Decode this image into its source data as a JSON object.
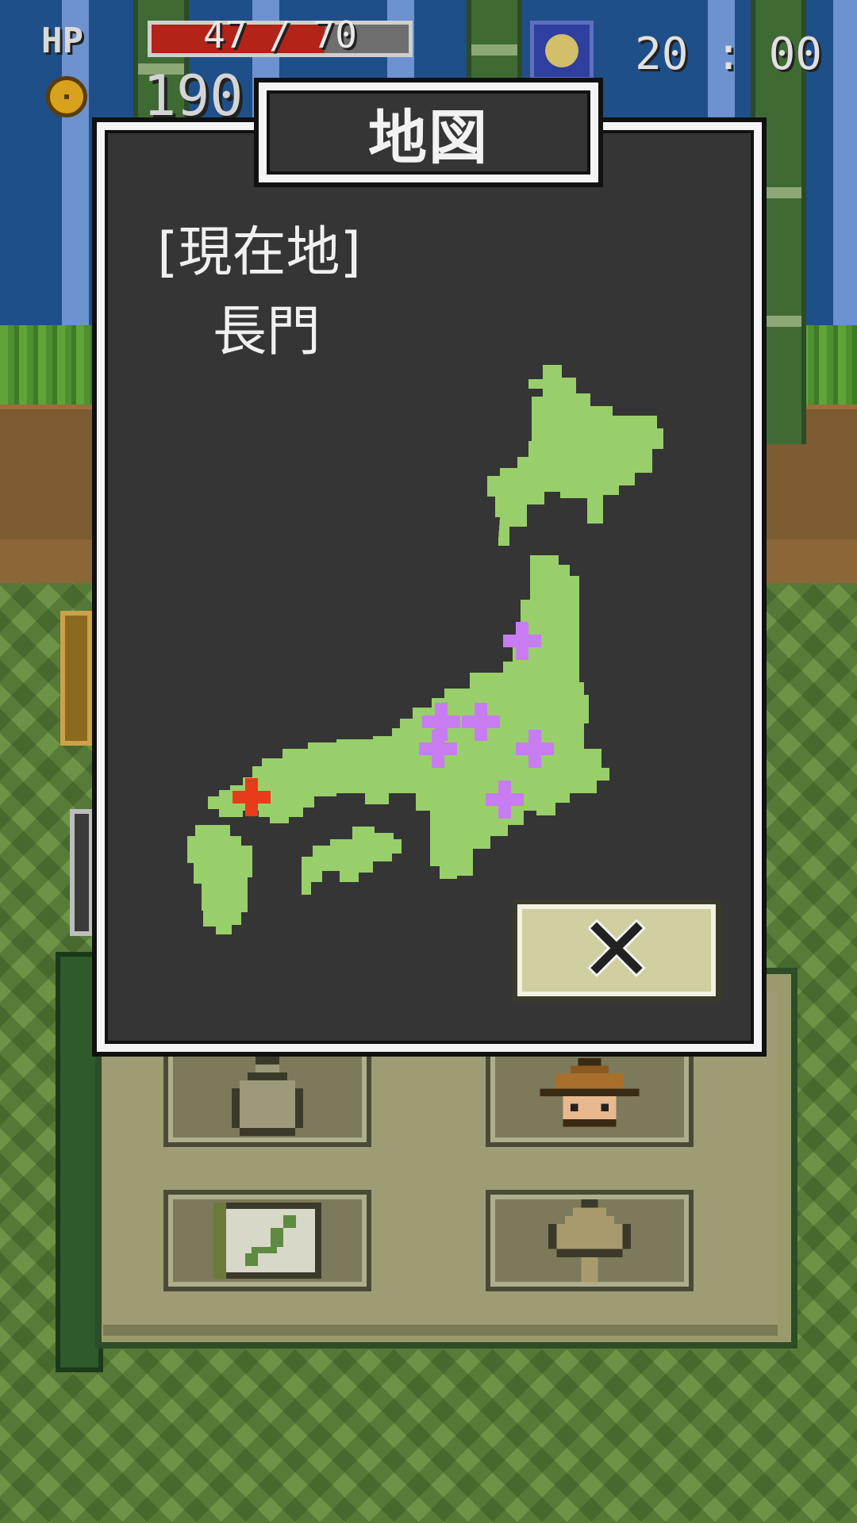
{
  "hud": {
    "hp_label": "HP",
    "hp_text": "47 / 70",
    "hp_current": 47,
    "hp_max": 70,
    "coins": "190",
    "clock": "20 : 00",
    "coin_icon": "mon-coin-icon",
    "time_icon": "night-moon-icon"
  },
  "dialog": {
    "title": "地図",
    "location_label": "[現在地]",
    "location_value": "長門",
    "close_label": "✕"
  },
  "map": {
    "land_color": "#99cf6a",
    "current_marker_color": "#e83b1a",
    "visited_marker_color": "#c77cf2"
  },
  "menu": {
    "items": [
      {
        "icon": "money-bag-icon"
      },
      {
        "icon": "straw-hat-icon"
      },
      {
        "icon": "japan-map-scroll-icon"
      },
      {
        "icon": "home-signpost-icon"
      }
    ]
  },
  "colors": {
    "hp_fill": "#b32318",
    "dialog_bg": "#353535",
    "dialog_border": "#f4f4f4",
    "close_button_bg": "#cfcf9f"
  }
}
